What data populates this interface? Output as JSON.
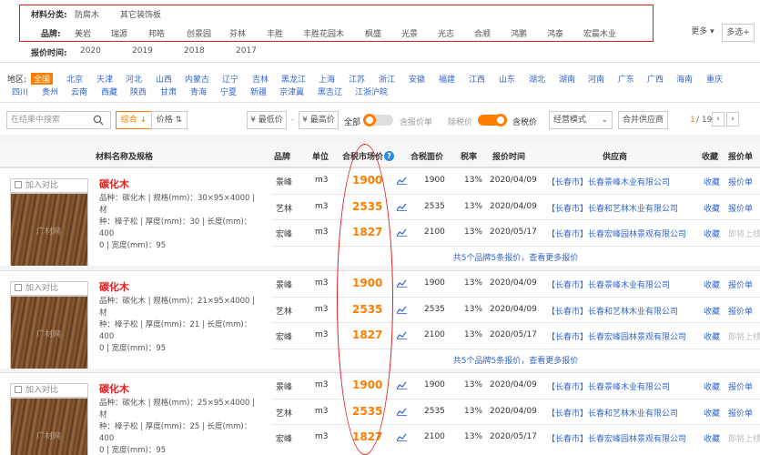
{
  "filters": {
    "category_label": "材料分类:",
    "categories": [
      "防腐木",
      "其它装饰板"
    ],
    "brand_label": "品牌:",
    "brands": [
      "美岩",
      "瑞源",
      "邦皓",
      "创景园",
      "芬林",
      "丰胜",
      "丰胜花园木",
      "枫盛",
      "光景",
      "光志",
      "合顺",
      "鸿鹏",
      "鸿泰",
      "宏晨木业"
    ],
    "more_label": "更多",
    "multi_label": "多选+",
    "time_label": "报价时间:",
    "years": [
      "2020",
      "2019",
      "2018",
      "2017"
    ]
  },
  "region": {
    "label": "地区:",
    "items": [
      "全国",
      "北京",
      "天津",
      "河北",
      "山西",
      "内蒙古",
      "辽宁",
      "吉林",
      "黑龙江",
      "上海",
      "江苏",
      "浙江",
      "安徽",
      "福建",
      "江西",
      "山东",
      "湖北",
      "湖南",
      "河南",
      "广东",
      "广西",
      "海南",
      "重庆",
      "四川",
      "贵州",
      "云南",
      "西藏",
      "陕西",
      "甘肃",
      "青海",
      "宁夏",
      "新疆",
      "京津冀",
      "黑吉辽",
      "江浙沪皖"
    ],
    "active": "全国"
  },
  "toolbar": {
    "search_placeholder": "在结果中搜索",
    "sort_composite": "综合",
    "sort_price": "价格",
    "min_price": "¥ 最低价",
    "max_price": "¥ 最高价",
    "all_label": "全部",
    "tax_quote_label": "含报价单",
    "ex_tax_label": "除税价",
    "tax_label": "含税价",
    "mode_select": "经营模式",
    "merge_supplier": "合并供应商",
    "page_current": "1",
    "page_total": "/ 19"
  },
  "table": {
    "headers": {
      "name": "材料名称及规格",
      "brand": "品牌",
      "unit": "单位",
      "market_price": "合税市场价",
      "area_price": "合税面价",
      "tax_rate": "税率",
      "quote_time": "报价时间",
      "supplier": "供应商",
      "favorite": "收藏",
      "quote_sheet": "报价单"
    },
    "products": [
      {
        "compare": "加入对比",
        "watermark": "广材网",
        "name": "碳化木",
        "spec_lines": [
          "品种：碳化木 | 规格(mm)：30×95×4000 | 材",
          "种：樟子松 | 厚度(mm)：30 | 长度(mm)：400",
          "0 | 宽度(mm)：95"
        ],
        "summary": "共5个品牌5条报价，查看更多报价",
        "rows": [
          {
            "brand": "景峰",
            "unit": "m3",
            "market": "1900",
            "area": "1900",
            "tax": "13%",
            "date": "2020/04/09",
            "supplier": "【长春市】长春景峰木业有限公司",
            "fav": "收藏",
            "quote": "报价单",
            "quote_disabled": false
          },
          {
            "brand": "艺林",
            "unit": "m3",
            "market": "2535",
            "area": "2535",
            "tax": "13%",
            "date": "2020/04/09",
            "supplier": "【长春市】长春和艺林木业有限公司",
            "fav": "收藏",
            "quote": "报价单",
            "quote_disabled": false
          },
          {
            "brand": "宏峰",
            "unit": "m3",
            "market": "1827",
            "area": "2100",
            "tax": "13%",
            "date": "2020/05/17",
            "supplier": "【长春市】长春宏峰园林景观有限公司",
            "fav": "收藏",
            "quote": "即将上线",
            "quote_disabled": true
          }
        ]
      },
      {
        "compare": "加入对比",
        "watermark": "广材网",
        "name": "碳化木",
        "spec_lines": [
          "品种：碳化木 | 规格(mm)：21×95×4000 | 材",
          "种：樟子松 | 厚度(mm)：21 | 长度(mm)：400",
          "0 | 宽度(mm)：95"
        ],
        "summary": "共5个品牌5条报价，查看更多报价",
        "rows": [
          {
            "brand": "景峰",
            "unit": "m3",
            "market": "1900",
            "area": "1900",
            "tax": "13%",
            "date": "2020/04/09",
            "supplier": "【长春市】长春景峰木业有限公司",
            "fav": "收藏",
            "quote": "报价单",
            "quote_disabled": false
          },
          {
            "brand": "艺林",
            "unit": "m3",
            "market": "2535",
            "area": "2535",
            "tax": "13%",
            "date": "2020/04/09",
            "supplier": "【长春市】长春和艺林木业有限公司",
            "fav": "收藏",
            "quote": "报价单",
            "quote_disabled": false
          },
          {
            "brand": "宏峰",
            "unit": "m3",
            "market": "1827",
            "area": "2100",
            "tax": "13%",
            "date": "2020/05/17",
            "supplier": "【长春市】长春宏峰园林景观有限公司",
            "fav": "收藏",
            "quote": "即将上线",
            "quote_disabled": true
          }
        ]
      },
      {
        "compare": "加入对比",
        "watermark": "广材网",
        "name": "碳化木",
        "spec_lines": [
          "品种：碳化木 | 规格(mm)：25×95×4000 | 材",
          "种：樟子松 | 厚度(mm)：25 | 长度(mm)：400",
          "0 | 宽度(mm)：95"
        ],
        "summary": "",
        "rows": [
          {
            "brand": "景峰",
            "unit": "m3",
            "market": "1900",
            "area": "1900",
            "tax": "13%",
            "date": "2020/04/09",
            "supplier": "【长春市】长春景峰木业有限公司",
            "fav": "收藏",
            "quote": "报价单",
            "quote_disabled": false
          },
          {
            "brand": "艺林",
            "unit": "m3",
            "market": "2535",
            "area": "2535",
            "tax": "13%",
            "date": "2020/04/09",
            "supplier": "【长春市】长春和艺林木业有限公司",
            "fav": "收藏",
            "quote": "报价单",
            "quote_disabled": false
          },
          {
            "brand": "宏峰",
            "unit": "m3",
            "market": "1827",
            "area": "2100",
            "tax": "13%",
            "date": "2020/05/17",
            "supplier": "【长春市】长春宏峰园林景观有限公司",
            "fav": "收藏",
            "quote": "即将上线",
            "quote_disabled": true
          }
        ]
      }
    ]
  },
  "colors": {
    "accent": "#ff7e00",
    "link": "#3366cc",
    "highlight": "#e02020"
  }
}
